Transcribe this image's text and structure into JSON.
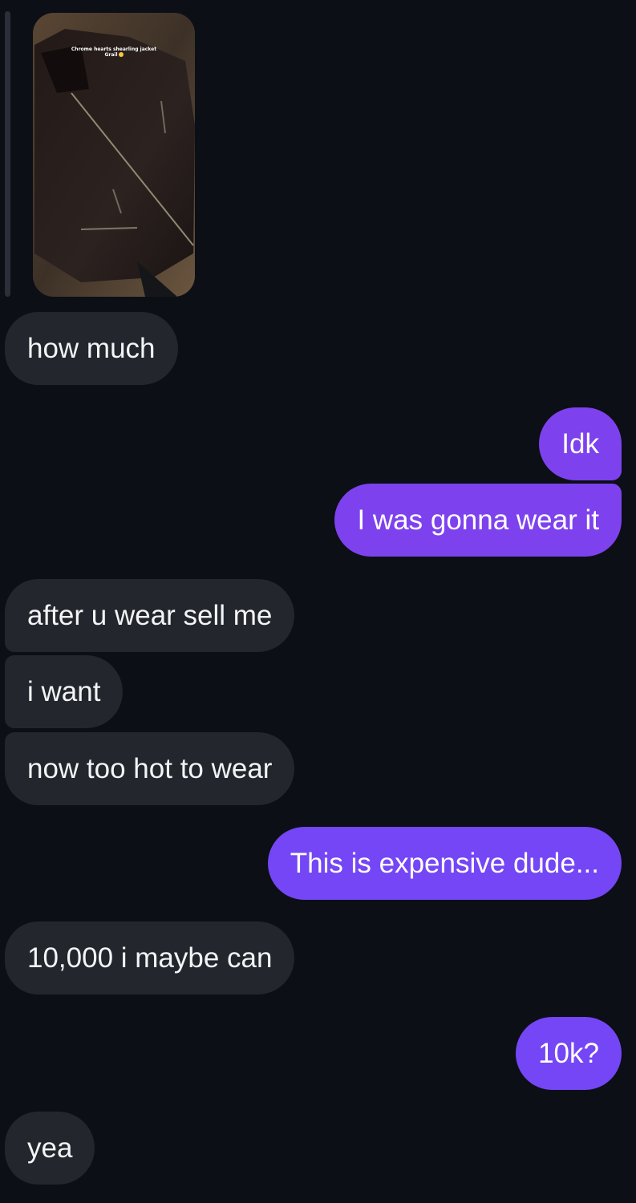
{
  "story_reply": {
    "caption_line1": "Chrome hearts shearling jacket",
    "caption_line2": "Grail"
  },
  "messages": [
    {
      "side": "received",
      "text": "how much"
    },
    {
      "side": "sent",
      "text": "Idk"
    },
    {
      "side": "sent",
      "text": "I was gonna wear it"
    },
    {
      "side": "received",
      "text": "after u wear sell me"
    },
    {
      "side": "received",
      "text": "i want"
    },
    {
      "side": "received",
      "text": "now too hot to wear"
    },
    {
      "side": "sent",
      "text": "This is expensive dude..."
    },
    {
      "side": "received",
      "text": "10,000 i maybe can"
    },
    {
      "side": "sent",
      "text": "10k?"
    },
    {
      "side": "received",
      "text": "yea"
    }
  ],
  "colors": {
    "background": "#0c0f15",
    "received_bubble": "#23262d",
    "sent_bubble": "#7d42ee",
    "text": "#f3f4f6"
  }
}
